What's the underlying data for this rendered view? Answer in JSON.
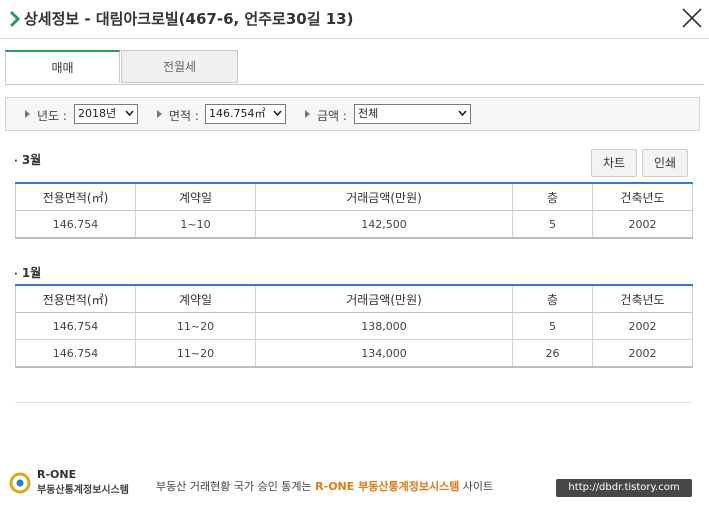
{
  "header": {
    "title": "상세정보 - 대림아크로빌(467-6, 언주로30길 13)",
    "accent_color": "#2a9a5c"
  },
  "tabs": [
    {
      "label": "매매",
      "active": true
    },
    {
      "label": "전월세",
      "active": false
    }
  ],
  "filters": {
    "year": {
      "label": "년도",
      "value": "2018년"
    },
    "area": {
      "label": "면적",
      "value": "146.754㎡"
    },
    "amount": {
      "label": "금액",
      "value": "전체"
    }
  },
  "actions": {
    "chart_label": "차트",
    "print_label": "인쇄"
  },
  "table_headers": [
    "전용면적(㎡)",
    "계약일",
    "거래금액(만원)",
    "층",
    "건축년도"
  ],
  "sections": [
    {
      "month": "3월",
      "rows": [
        [
          "146.754",
          "1~10",
          "142,500",
          "5",
          "2002"
        ]
      ]
    },
    {
      "month": "1월",
      "rows": [
        [
          "146.754",
          "11~20",
          "138,000",
          "5",
          "2002"
        ],
        [
          "146.754",
          "11~20",
          "134,000",
          "26",
          "2002"
        ]
      ]
    }
  ],
  "footer": {
    "logo_top": "R-ONE",
    "logo_bottom": "부동산통계정보시스템",
    "text_before": "부동산 거래현황 국가 승인 통계는 ",
    "text_highlight": "R-ONE 부동산통계정보시스템",
    "text_after": " 사이트",
    "highlight_color": "#e07b17"
  },
  "watermark": "http://dbdr.tistory.com"
}
